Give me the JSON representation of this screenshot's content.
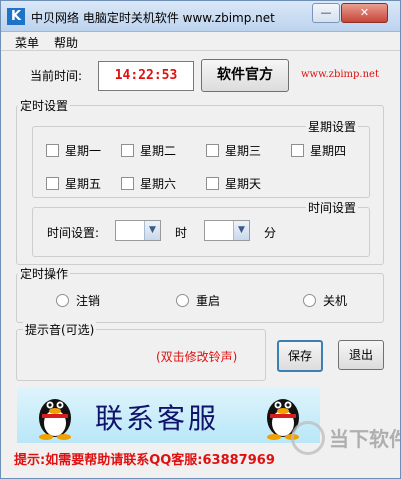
{
  "window": {
    "title": "中贝网络 电脑定时关机软件 www.zbimp.net",
    "icon_letter": "K",
    "minimize_glyph": "—",
    "close_glyph": "✕"
  },
  "menu": {
    "items": [
      "菜单",
      "帮助"
    ]
  },
  "clock": {
    "label": "当前时间:",
    "value": "14:22:53",
    "official_button": "软件官方",
    "site": "www.zbimp.net"
  },
  "timer_settings": {
    "title": "定时设置",
    "weekday_group": {
      "title": "星期设置",
      "days": [
        "星期一",
        "星期二",
        "星期三",
        "星期四",
        "星期五",
        "星期六",
        "星期天"
      ]
    },
    "time_group": {
      "title": "时间设置",
      "label": "时间设置:",
      "hour_unit": "时",
      "minute_unit": "分",
      "hour_value": "",
      "minute_value": ""
    }
  },
  "action": {
    "title": "定时操作",
    "options": [
      "注销",
      "重启",
      "关机"
    ]
  },
  "sound": {
    "title": "提示音(可选)",
    "hint": "(双击修改铃声)"
  },
  "buttons": {
    "save": "保存",
    "exit": "退出"
  },
  "banner": {
    "text": "联系客服"
  },
  "footer": {
    "tip": "提示:如需要帮助请联系QQ客服:63887969"
  },
  "watermark": {
    "text": "当下软件园"
  },
  "colors": {
    "accent_red": "#e01010",
    "banner_text": "#10136a",
    "banner_bg": "#c6ecfa"
  }
}
